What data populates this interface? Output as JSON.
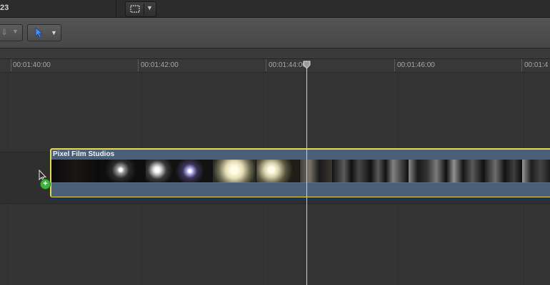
{
  "topbar": {
    "project_label": "23",
    "view_button_icon": "clip-appearance-icon"
  },
  "toolbar": {
    "left_tool_icon": "edit-tool-icon",
    "select_tool_icon": "arrow-pointer-icon",
    "accent_color": "#4a8cf0"
  },
  "ruler": {
    "timecodes": [
      "00:01:40:00",
      "00:01:42:00",
      "00:01:44:00",
      "00:01:46:00",
      "00:01:4"
    ]
  },
  "clip": {
    "title": "Pixel Film Studios",
    "selected_border_color": "#e9d84a"
  },
  "playhead": {
    "timecode_label": "00:01:44:00"
  },
  "cursor": {
    "badge": "+"
  }
}
